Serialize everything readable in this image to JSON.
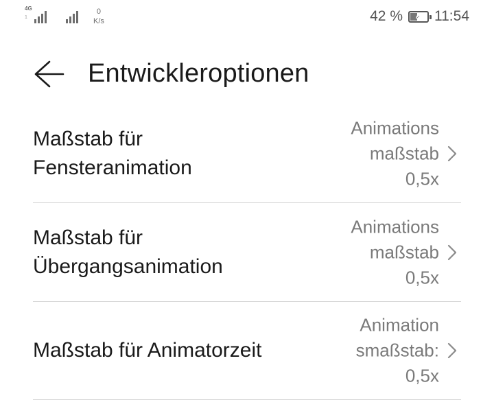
{
  "status_bar": {
    "signal1_label": "4G",
    "signal1_sublabel": "1",
    "net_speed_value": "0",
    "net_speed_unit": "K/s",
    "battery_percent": "42 %",
    "battery_level": 0.42,
    "time": "11:54"
  },
  "header": {
    "title": "Entwickleroptionen",
    "back_icon": "arrow-left-icon"
  },
  "settings": [
    {
      "title_line1": "Maßstab für",
      "title_line2": "Fensteranimation",
      "value_line1": "Animations",
      "value_line2": "maßstab",
      "value_line3": "0,5x"
    },
    {
      "title_line1": "Maßstab für",
      "title_line2": "Übergangsanimation",
      "value_line1": "Animations",
      "value_line2": "maßstab",
      "value_line3": "0,5x"
    },
    {
      "title_line1": "Maßstab für Animatorzeit",
      "title_line2": "",
      "value_line1": "Animation",
      "value_line2": "smaßstab:",
      "value_line3": "0,5x"
    }
  ],
  "colors": {
    "text": "#1a1a1a",
    "secondary_text": "#7a7a7a",
    "divider": "#d6d6d6",
    "status_icons": "#555555"
  }
}
